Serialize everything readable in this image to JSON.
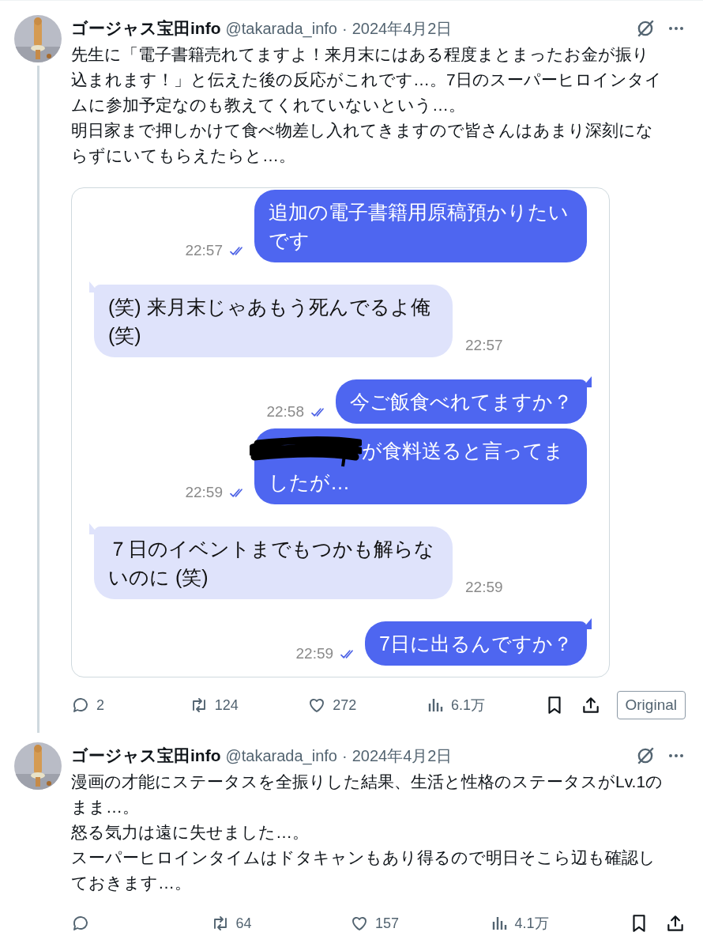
{
  "tweets": [
    {
      "author": {
        "name": "ゴージャス宝田info",
        "handle": "@takarada_info",
        "separator": "·",
        "date": "2024年4月2日"
      },
      "thread_line": true,
      "paragraphs": [
        "先生に「電子書籍売れてますよ！来月末にはある程度まとまったお金が振り込まれます！」と伝えた後の反応がこれです…。7日のスーパーヒロインタイムに参加予定なのも教えてくれていないという…。",
        "明日家まで押しかけて食べ物差し入れてきますので皆さんはあまり深刻にならずにいてもらえたらと…。"
      ],
      "chat": {
        "messages": [
          {
            "kind": "sent",
            "text": "追加の電子書籍用原稿預かりたいです",
            "time": "22:57",
            "read": true,
            "tail": false,
            "redacted": false
          },
          {
            "kind": "received",
            "text": "(笑) 来月末じゃあもう死んでるよ俺 (笑)",
            "time": "22:57",
            "read": false,
            "tail": true,
            "redacted": false
          },
          {
            "kind": "sent",
            "text": "今ご飯食べれてますか？",
            "time": "22:58",
            "read": true,
            "tail": true,
            "redacted": false
          },
          {
            "kind": "sent",
            "text": "が食料送ると言ってましたが…",
            "time": "22:59",
            "read": true,
            "tail": false,
            "redacted": true
          },
          {
            "kind": "received",
            "text": "７日のイベントまでもつかも解らないのに (笑)",
            "time": "22:59",
            "read": false,
            "tail": true,
            "redacted": false
          },
          {
            "kind": "sent",
            "text": "7日に出るんですか？",
            "time": "22:59",
            "read": true,
            "tail": true,
            "redacted": false
          }
        ]
      },
      "actions": {
        "replies": "2",
        "reposts": "124",
        "likes": "272",
        "views": "6.1万",
        "original_button": "Original"
      }
    },
    {
      "author": {
        "name": "ゴージャス宝田info",
        "handle": "@takarada_info",
        "separator": "·",
        "date": "2024年4月2日"
      },
      "thread_line": false,
      "paragraphs": [
        "漫画の才能にステータスを全振りした結果、生活と性格のステータスがLv.1のまま…。",
        "怒る気力は遠に失せました…。",
        "スーパーヒロインタイムはドタキャンもあり得るので明日そこら辺も確認しておきます…。"
      ],
      "actions": {
        "reposts": "64",
        "likes": "157",
        "views": "4.1万"
      }
    }
  ]
}
